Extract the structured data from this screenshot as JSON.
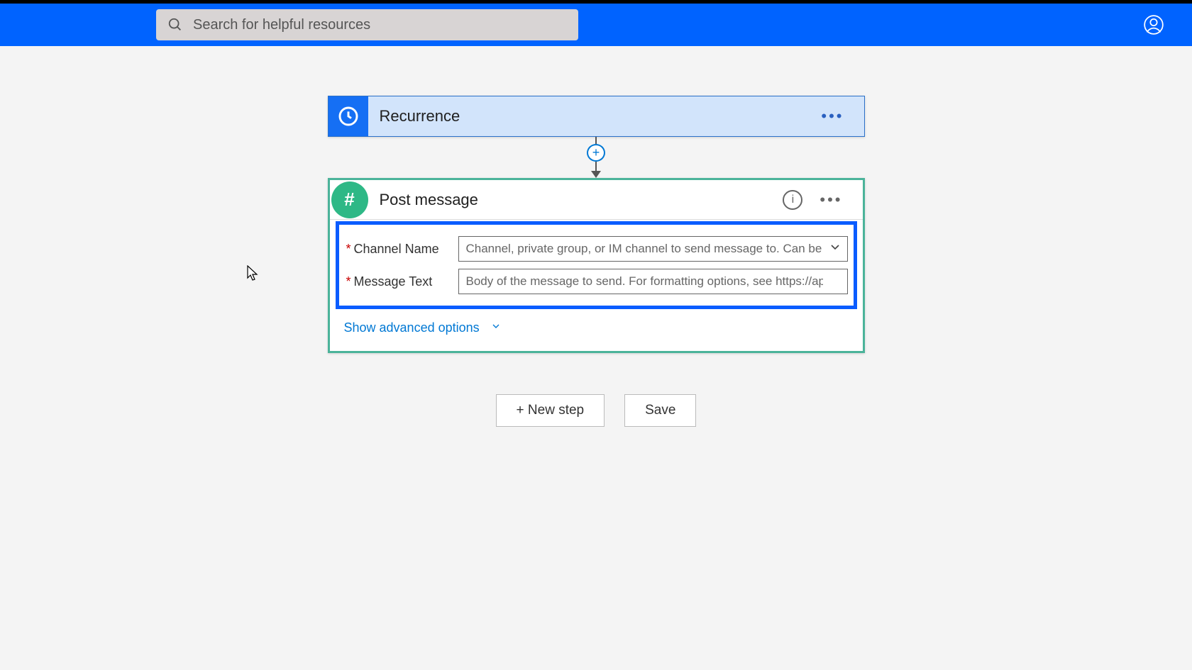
{
  "search": {
    "placeholder": "Search for helpful resources"
  },
  "recurrence": {
    "title": "Recurrence"
  },
  "postmsg": {
    "title": "Post message",
    "channel_label": "Channel Name",
    "channel_placeholder": "Channel, private group, or IM channel to send message to. Can be a nam",
    "message_label": "Message Text",
    "message_placeholder": "Body of the message to send. For formatting options, see https://api.slack.com",
    "advanced": "Show advanced options"
  },
  "buttons": {
    "new_step": "+ New step",
    "save": "Save"
  }
}
